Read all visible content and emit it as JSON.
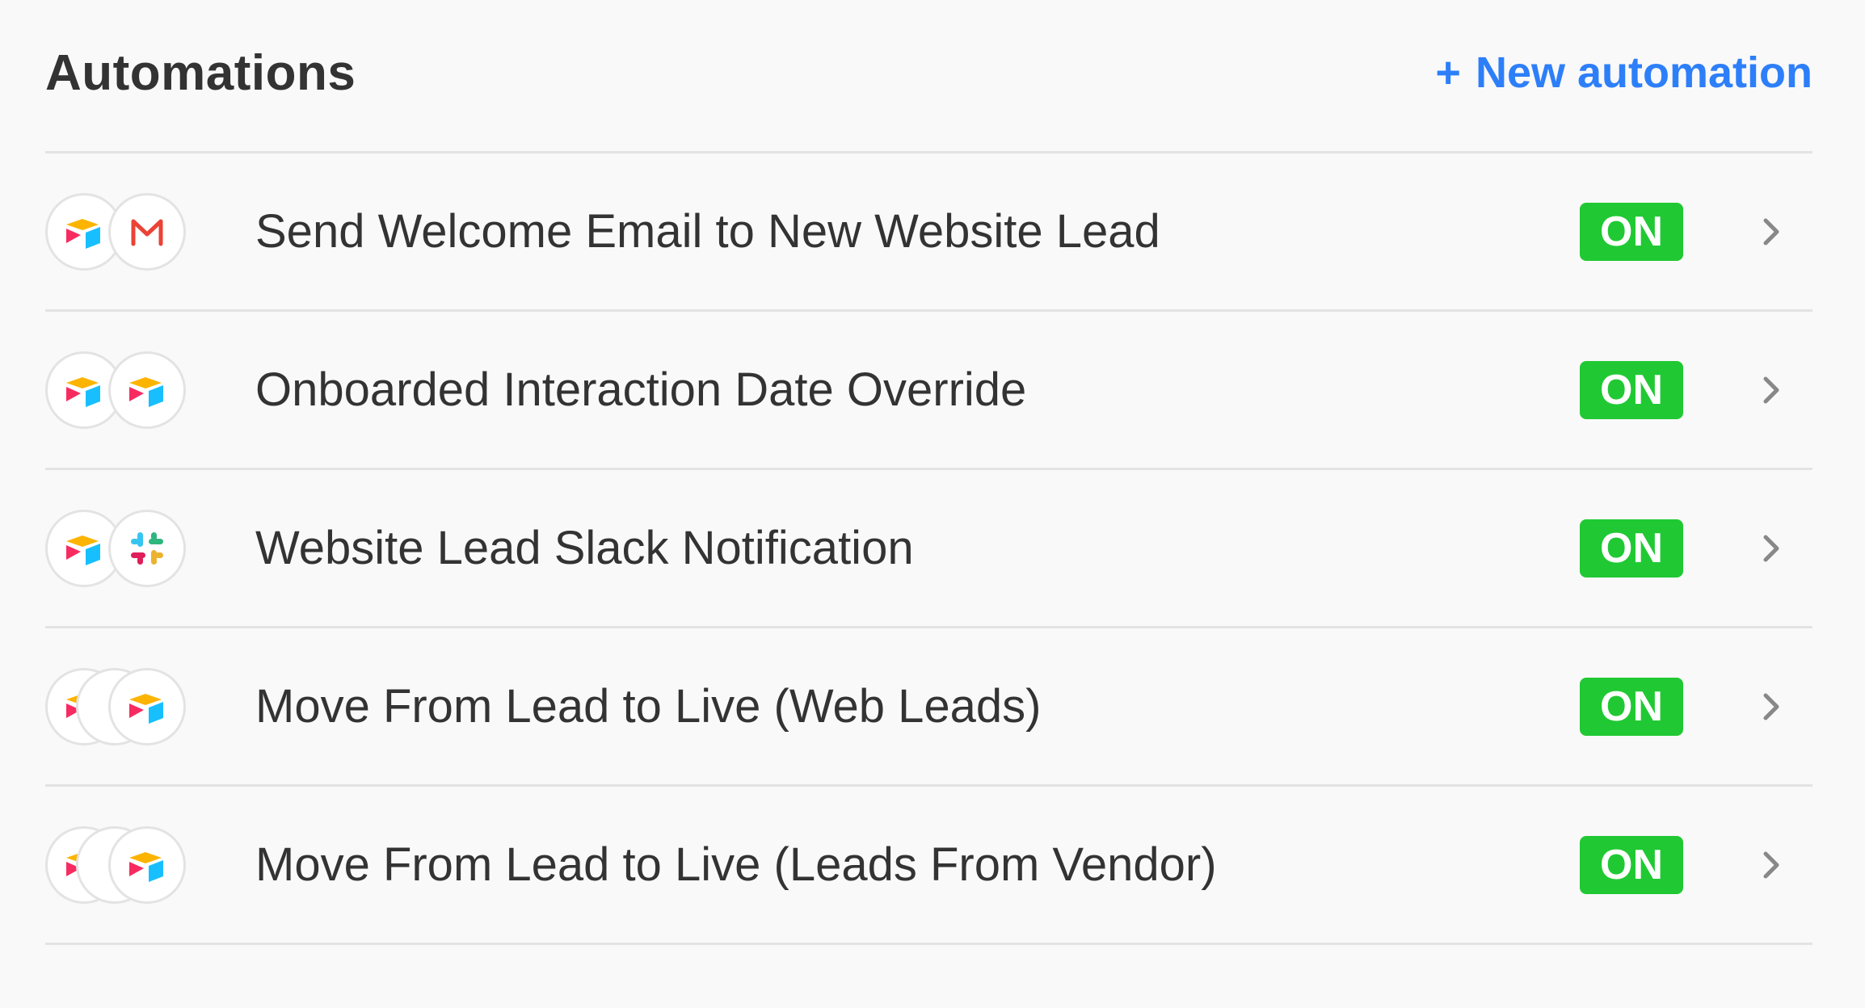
{
  "header": {
    "title": "Automations",
    "new_automation_plus": "+",
    "new_automation_label": "New automation"
  },
  "colors": {
    "accent": "#2d7ff9",
    "status_on": "#20c933",
    "gmail_red": "#ea4335"
  },
  "automations": [
    {
      "label": "Send Welcome Email to New Website Lead",
      "status": "ON",
      "icons": [
        "airtable-icon",
        "gmail-icon"
      ]
    },
    {
      "label": "Onboarded Interaction Date Override",
      "status": "ON",
      "icons": [
        "airtable-icon",
        "airtable-icon"
      ]
    },
    {
      "label": "Website Lead Slack Notification",
      "status": "ON",
      "icons": [
        "airtable-icon",
        "slack-icon"
      ]
    },
    {
      "label": "Move From Lead to Live (Web Leads)",
      "status": "ON",
      "icons": [
        "airtable-icon",
        "ellipsis-icon",
        "airtable-icon"
      ]
    },
    {
      "label": "Move From Lead to Live (Leads From Vendor)",
      "status": "ON",
      "icons": [
        "airtable-icon",
        "ellipsis-icon",
        "airtable-icon"
      ]
    }
  ]
}
